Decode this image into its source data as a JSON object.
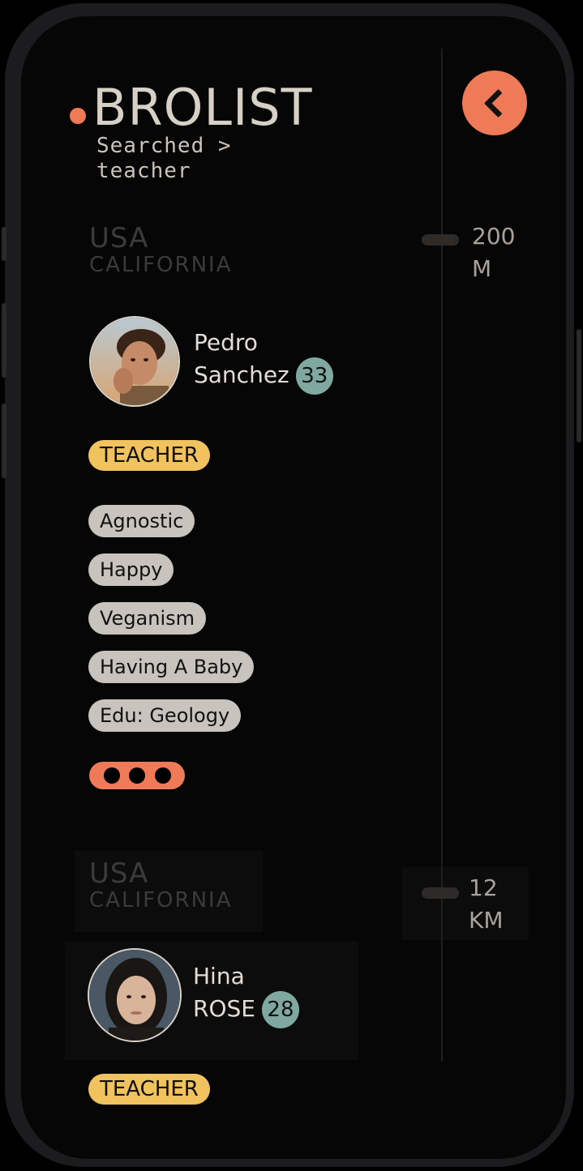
{
  "header": {
    "title": "BROLIST",
    "breadcrumb_line1": "Searched >",
    "breadcrumb_line2": "teacher"
  },
  "colors": {
    "accent": "#ef7a57",
    "role_tag": "#f0c35f",
    "age_badge": "#7fa9a0",
    "interest_tag": "#c9c3bd"
  },
  "profiles": [
    {
      "country": "USA",
      "region": "CALIFORNIA",
      "distance_value": "200",
      "distance_unit": "M",
      "first_name": "Pedro",
      "last_name": "Sanchez",
      "age": "33",
      "role": "TEACHER",
      "interests": [
        "Agnostic",
        "Happy",
        "Veganism",
        "Having A Baby",
        "Edu: Geology"
      ]
    },
    {
      "country": "USA",
      "region": "CALIFORNIA",
      "distance_value": "12",
      "distance_unit": "KM",
      "first_name": "Hina",
      "last_name": "ROSE",
      "age": "28",
      "role": "TEACHER"
    }
  ],
  "icons": {
    "back": "chevron-left-icon",
    "more": "more-dots-icon"
  }
}
